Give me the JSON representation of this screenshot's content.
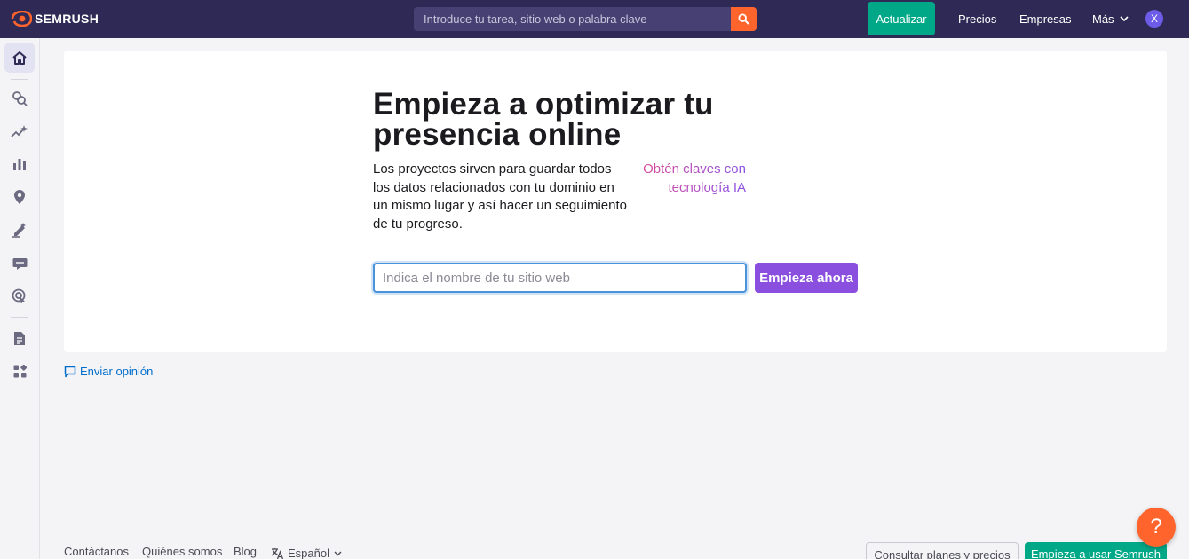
{
  "brand": {
    "name": "SEMRUSH",
    "logo_icon": "semrush-fire-icon",
    "accent": "#ff642d"
  },
  "header": {
    "search_placeholder": "Introduce tu tarea, sitio web o palabra clave",
    "upgrade_label": "Actualizar",
    "pricing_label": "Precios",
    "business_label": "Empresas",
    "more_label": "Más",
    "avatar_initial": "X"
  },
  "sidebar": {
    "items": [
      {
        "name": "home-icon",
        "active": true
      },
      {
        "name": "seo-icon"
      },
      {
        "name": "ai-sparkle-icon"
      },
      {
        "name": "bar-chart-icon"
      },
      {
        "name": "location-pin-icon"
      },
      {
        "name": "content-pen-icon"
      },
      {
        "name": "chat-bubble-icon"
      },
      {
        "name": "social-target-icon"
      },
      {
        "name": "report-document-icon"
      },
      {
        "name": "apps-grid-icon"
      }
    ]
  },
  "main": {
    "title": "Empieza a optimizar tu presencia online",
    "description": "Los proyectos sirven para guardar todos los datos relacionados con tu dominio en un mismo lugar y así hacer un seguimiento de tu progreso.",
    "ai_link": "Obtén claves con tecnología IA",
    "site_input_placeholder": "Indica el nombre de tu sitio web",
    "start_button": "Empieza ahora"
  },
  "feedback_label": "Enviar opinión",
  "footer": {
    "contact": "Contáctanos",
    "about": "Quiénes somos",
    "blog": "Blog",
    "language": "Español",
    "plans_button": "Consultar planes y precios",
    "start_button": "Empieza a usar Semrush"
  },
  "help_label": "?"
}
